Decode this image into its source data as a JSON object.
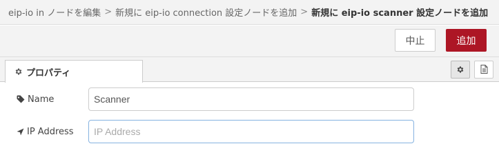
{
  "breadcrumb": {
    "items": [
      "eip-io in ノードを編集",
      "新規に eip-io connection 設定ノードを追加"
    ],
    "separator": ">",
    "current": "新規に eip-io scanner 設定ノードを追加"
  },
  "toolbar": {
    "cancel_label": "中止",
    "add_label": "追加",
    "add_color": "#ad1625"
  },
  "tabs": {
    "properties_label": "プロパティ",
    "properties_icon": "gear-icon",
    "side_buttons": [
      "gear-icon",
      "document-icon"
    ]
  },
  "form": {
    "name": {
      "label": "Name",
      "icon": "tag-icon",
      "value": "Scanner"
    },
    "ip": {
      "label": "IP Address",
      "icon": "location-arrow-icon",
      "value": "",
      "placeholder": "IP Address"
    }
  }
}
